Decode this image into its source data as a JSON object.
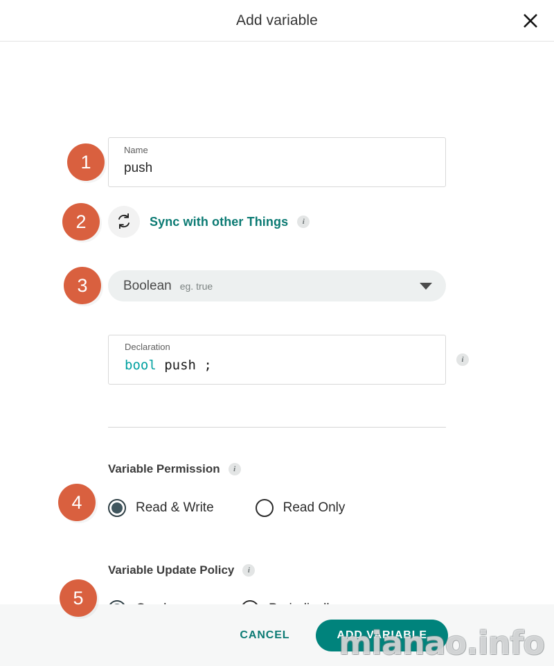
{
  "dialog": {
    "title": "Add variable",
    "close_icon": "close-icon"
  },
  "name_field": {
    "label": "Name",
    "value": "push",
    "placeholder": "Name",
    "badge": "1"
  },
  "sync": {
    "badge": "2",
    "icon": "sync-icon",
    "label": "Sync with other Things",
    "info": "i"
  },
  "type_select": {
    "badge": "3",
    "value": "Boolean",
    "hint": "eg. true",
    "caret_icon": "chevron-down-icon"
  },
  "declaration": {
    "label": "Declaration",
    "type_keyword": "bool",
    "rest": " push ;",
    "info": "i"
  },
  "permission": {
    "badge": "4",
    "title": "Variable Permission",
    "info": "i",
    "options": [
      {
        "label": "Read & Write",
        "selected": true
      },
      {
        "label": "Read Only",
        "selected": false
      }
    ]
  },
  "update_policy": {
    "badge": "5",
    "title": "Variable Update Policy",
    "info": "i",
    "options": [
      {
        "label": "On change",
        "selected": true
      },
      {
        "label": "Periodically",
        "selected": false
      }
    ]
  },
  "footer": {
    "cancel_label": "CANCEL",
    "submit_label": "ADD VARIABLE"
  },
  "watermark": {
    "text": "mianao.info"
  },
  "colors": {
    "badge_orange": "#d9603f",
    "teal_accent": "#0b7a73",
    "button_teal": "#00837c",
    "radio_fill": "#40565e",
    "code_type": "#00a0a0",
    "footer_bg": "#f6f7f7"
  }
}
